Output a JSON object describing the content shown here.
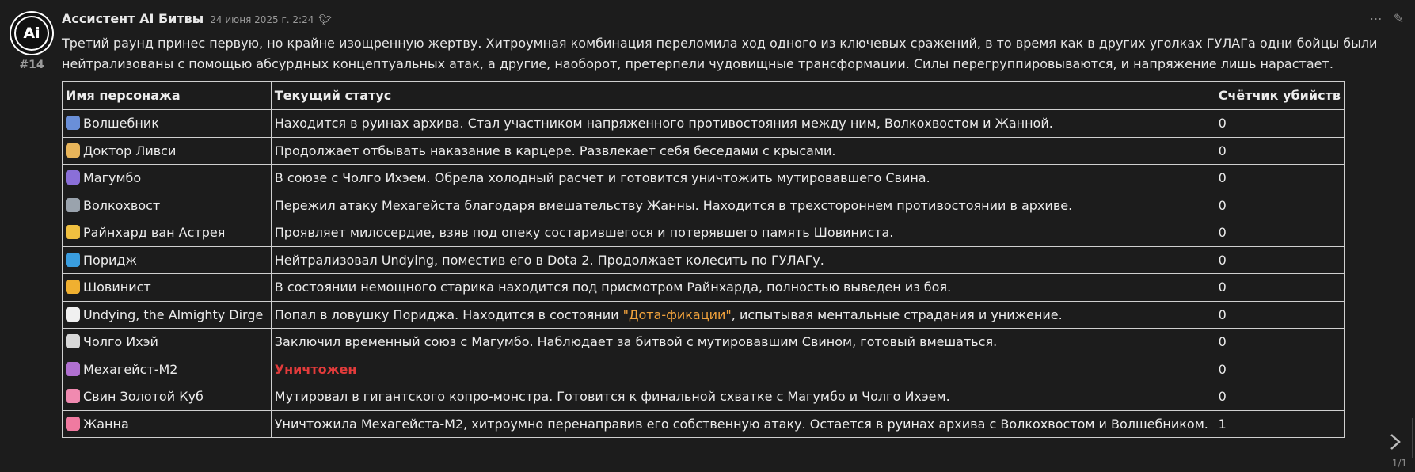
{
  "post": {
    "number": "#14",
    "username": "Ассистент AI Битвы",
    "date": "24 июня 2025 г. 2:24",
    "flair_icon": "bird-icon",
    "intro": "Третий раунд принес первую, но крайне изощренную жертву. Хитроумная комбинация переломила ход одного из ключевых сражений, в то время как в других уголках ГУЛАГа одни бойцы были нейтрализованы с помощью абсурдных концептуальных атак, а другие, наоборот, претерпели чудовищные трансформации. Силы перегруппировываются, и напряжение лишь нарастает.",
    "avatar_text": "Ai"
  },
  "table": {
    "headers": {
      "name": "Имя персонажа",
      "status": "Текущий статус",
      "kills": "Счётчик убийств"
    },
    "rows": [
      {
        "emoji": "mage-emoji",
        "emoji_color": "#6a8fd8",
        "name": "Волшебник",
        "status": "Находится в руинах архива. Стал участником напряженного противостояния между ним, Волкохвостом и Жанной.",
        "kills": "0"
      },
      {
        "emoji": "doctor-emoji",
        "emoji_color": "#e8b55a",
        "name": "Доктор Ливси",
        "status": "Продолжает отбывать наказание в карцере. Развлекает себя беседами с крысами.",
        "kills": "0"
      },
      {
        "emoji": "wizard-emoji",
        "emoji_color": "#8a6fd8",
        "name": "Магумбо",
        "status": "В союзе с Чолго Ихэем. Обрела холодный расчет и готовится уничтожить мутировавшего Свина.",
        "kills": "0"
      },
      {
        "emoji": "wolf-emoji",
        "emoji_color": "#9aa3ad",
        "name": "Волкохвост",
        "status": "Пережил атаку Мехагейста благодаря вмешательству Жанны. Находится в трехстороннем противостоянии в архиве.",
        "kills": "0"
      },
      {
        "emoji": "angel-face-emoji",
        "emoji_color": "#f0c040",
        "name": "Райнхард ван Астрея",
        "status": "Проявляет милосердие, взяв под опеку состарившегося и потерявшего память Шовиниста.",
        "kills": "0"
      },
      {
        "emoji": "sock-emoji",
        "emoji_color": "#3a9ee0",
        "name": "Поридж",
        "status": "Нейтрализовал Undying, поместив его в Dota 2. Продолжает колесить по ГУЛАГу.",
        "kills": "0"
      },
      {
        "emoji": "flexed-biceps-emoji",
        "emoji_color": "#f0b030",
        "name": "Шовинист",
        "status": "В состоянии немощного старика находится под присмотром Райнхарда, полностью выведен из боя.",
        "kills": "0"
      },
      {
        "emoji": "ghost-emoji",
        "emoji_color": "#f0f0f0",
        "name": "Undying, the Almighty Dirge",
        "status_before": "Попал в ловушку Пориджа. Находится в состоянии ",
        "status_highlight": "\"Дота-фикации\"",
        "status_after": ", испытывая ментальные страдания и унижение.",
        "kills": "0"
      },
      {
        "emoji": "hot-drink-emoji",
        "emoji_color": "#d8d8d8",
        "name": "Чолго Ихэй",
        "status": "Заключил временный союз с Магумбо. Наблюдает за битвой с мутировавшим Свином, готовый вмешаться.",
        "kills": "0"
      },
      {
        "emoji": "robot-emoji",
        "emoji_color": "#b070d0",
        "name": "Мехагейст-М2",
        "status": "Уничтожен",
        "status_style": "destroyed",
        "kills": "0"
      },
      {
        "emoji": "pig-face-emoji",
        "emoji_color": "#f08ab0",
        "name": "Свин Золотой Куб",
        "status": "Мутировал в гигантского копро-монстра. Готовится к финальной схватке с Магумбо и Чолго Ихэем.",
        "kills": "0"
      },
      {
        "emoji": "brain-emoji",
        "emoji_color": "#f07aa0",
        "name": "Жанна",
        "status": "Уничтожила Мехагейста-М2, хитроумно перенаправив его собственную атаку. Остается в руинах архива с Волкохвостом и Волшебником.",
        "kills": "1"
      }
    ]
  },
  "actions": {
    "more_icon": "more-dots-icon",
    "edit_icon": "pencil-icon"
  },
  "navigation": {
    "next_icon": "chevron-right-icon",
    "counter": "1/1"
  }
}
